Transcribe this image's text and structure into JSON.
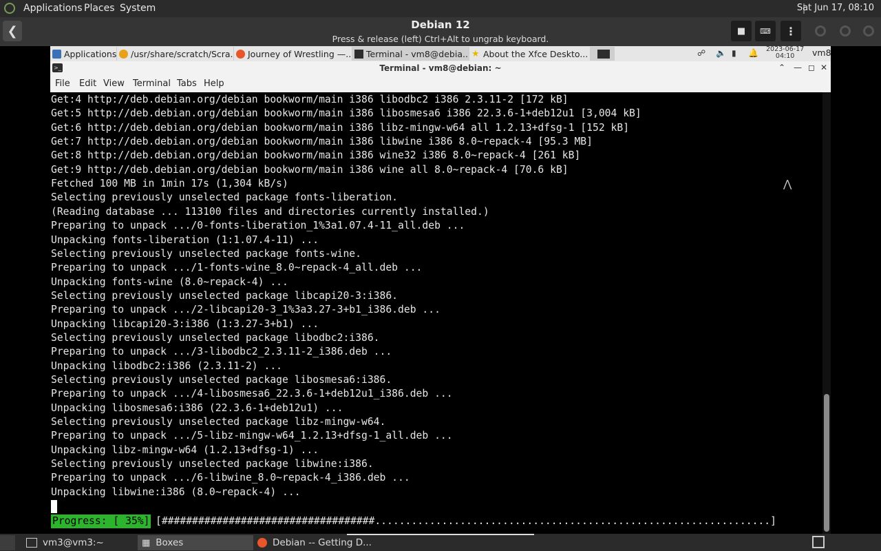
{
  "host": {
    "menu": [
      "Applications",
      "Places",
      "System"
    ],
    "clock": "Sat Jun 17, 08:10"
  },
  "boxes": {
    "title": "Debian 12",
    "subtitle": "Press & release (left) Ctrl+Alt to ungrab keyboard."
  },
  "guest_panel": {
    "tasks": [
      {
        "label": "Applications :",
        "icon": "xfce-menu-icon"
      },
      {
        "label": "/usr/share/scratch/Scra...",
        "icon": "scratch-icon"
      },
      {
        "label": "Journey of Wrestling —...",
        "icon": "firefox-icon"
      },
      {
        "label": "Terminal - vm8@debia...",
        "icon": "terminal-icon"
      },
      {
        "label": "About the Xfce Deskto...",
        "icon": "star-icon"
      }
    ],
    "clock_date": "2023-06-17",
    "clock_time": "04:10",
    "user": "vm8"
  },
  "terminal": {
    "title": "Terminal - vm8@debian: ~",
    "menu": [
      "File",
      "Edit",
      "View",
      "Terminal",
      "Tabs",
      "Help"
    ],
    "lines": [
      "Get:4 http://deb.debian.org/debian bookworm/main i386 libodbc2 i386 2.3.11-2 [172 kB]",
      "Get:5 http://deb.debian.org/debian bookworm/main i386 libosmesa6 i386 22.3.6-1+deb12u1 [3,004 kB]",
      "Get:6 http://deb.debian.org/debian bookworm/main i386 libz-mingw-w64 all 1.2.13+dfsg-1 [152 kB]",
      "Get:7 http://deb.debian.org/debian bookworm/main i386 libwine i386 8.0~repack-4 [95.3 MB]",
      "Get:8 http://deb.debian.org/debian bookworm/main i386 wine32 i386 8.0~repack-4 [261 kB]",
      "Get:9 http://deb.debian.org/debian bookworm/main i386 wine all 8.0~repack-4 [70.6 kB]",
      "Fetched 100 MB in 1min 17s (1,304 kB/s)",
      "Selecting previously unselected package fonts-liberation.",
      "(Reading database ... 113100 files and directories currently installed.)",
      "Preparing to unpack .../0-fonts-liberation_1%3a1.07.4-11_all.deb ...",
      "Unpacking fonts-liberation (1:1.07.4-11) ...",
      "Selecting previously unselected package fonts-wine.",
      "Preparing to unpack .../1-fonts-wine_8.0~repack-4_all.deb ...",
      "Unpacking fonts-wine (8.0~repack-4) ...",
      "Selecting previously unselected package libcapi20-3:i386.",
      "Preparing to unpack .../2-libcapi20-3_1%3a3.27-3+b1_i386.deb ...",
      "Unpacking libcapi20-3:i386 (1:3.27-3+b1) ...",
      "Selecting previously unselected package libodbc2:i386.",
      "Preparing to unpack .../3-libodbc2_2.3.11-2_i386.deb ...",
      "Unpacking libodbc2:i386 (2.3.11-2) ...",
      "Selecting previously unselected package libosmesa6:i386.",
      "Preparing to unpack .../4-libosmesa6_22.3.6-1+deb12u1_i386.deb ...",
      "Unpacking libosmesa6:i386 (22.3.6-1+deb12u1) ...",
      "Selecting previously unselected package libz-mingw-w64.",
      "Preparing to unpack .../5-libz-mingw-w64_1.2.13+dfsg-1_all.deb ...",
      "Unpacking libz-mingw-w64 (1.2.13+dfsg-1) ...",
      "Selecting previously unselected package libwine:i386.",
      "Preparing to unpack .../6-libwine_8.0~repack-4_i386.deb ...",
      "Unpacking libwine:i386 (8.0~repack-4) ..."
    ],
    "progress_label": "Progress: [ 35%]",
    "progress_bar": "[###################################.................................................................]",
    "progress_fraction": 0.35
  },
  "host_taskbar": {
    "tasks": [
      {
        "label": "vm3@vm3:~",
        "icon": "terminal-icon"
      },
      {
        "label": "Boxes",
        "icon": "boxes-icon"
      },
      {
        "label": "Debian -- Getting D...",
        "icon": "firefox-icon"
      }
    ]
  }
}
